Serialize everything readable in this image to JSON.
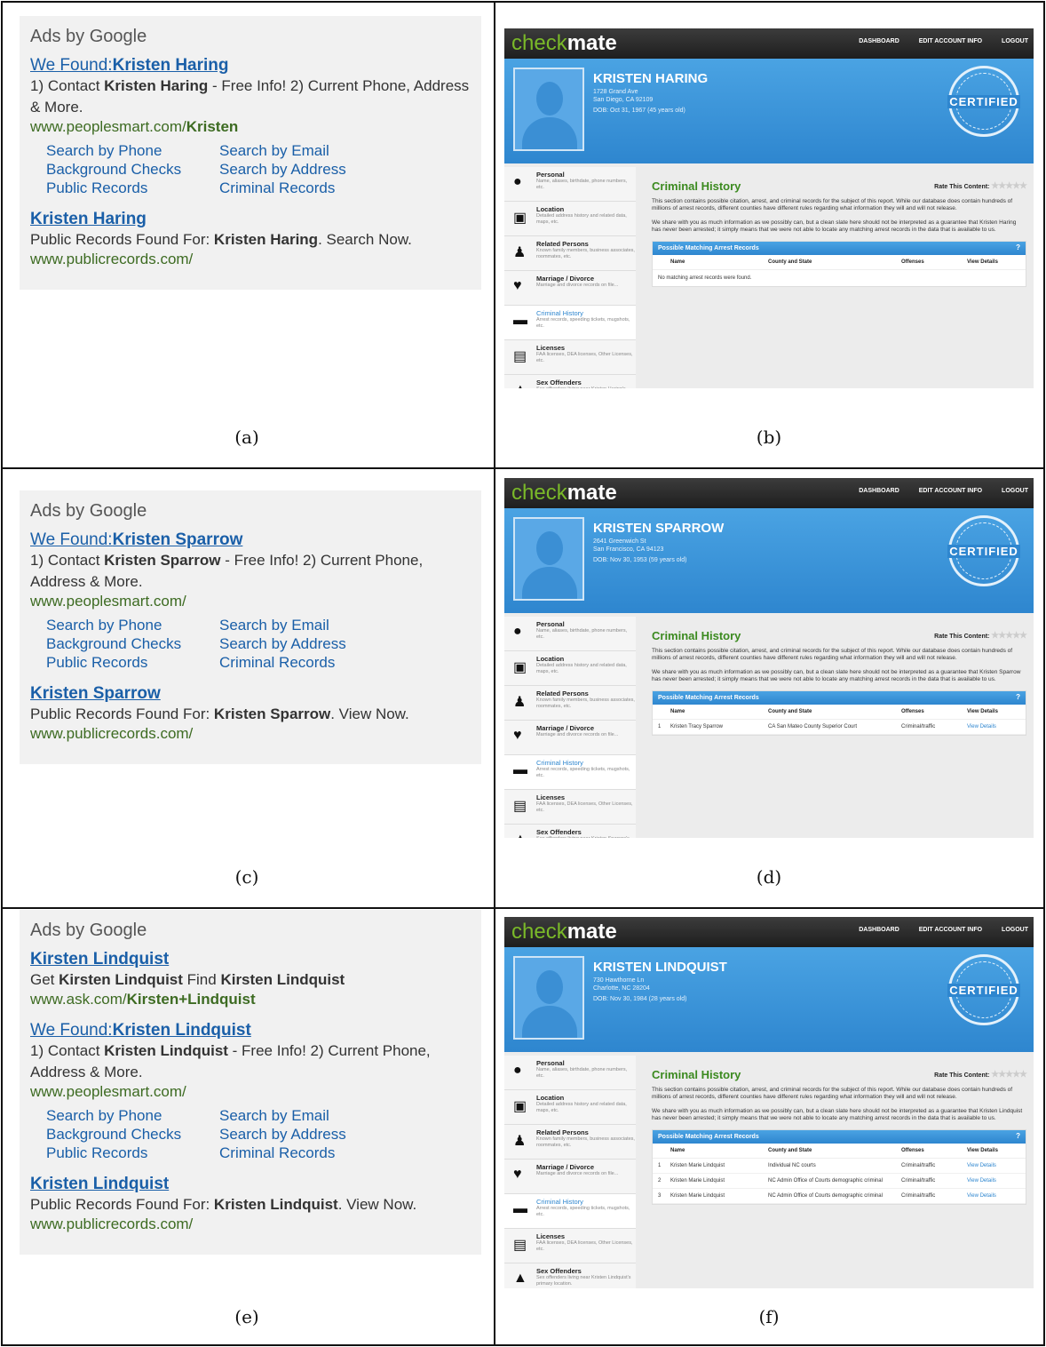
{
  "captions": [
    "(a)",
    "(b)",
    "(c)",
    "(d)",
    "(e)",
    "(f)"
  ],
  "ads": [
    {
      "header": "Ads by Google",
      "blocks": [
        {
          "title_prefix": "We Found:",
          "title_name": "Kristen Haring",
          "desc_a": "1) Contact ",
          "desc_name": "Kristen Haring",
          "desc_b": " - Free Info! 2) Current Phone, Address & More.",
          "url_prefix": "www.peoplesmart.com/",
          "url_bold": "Kristen",
          "links": [
            "Search by Phone",
            "Search by Email",
            "Background Checks",
            "Search by Address",
            "Public Records",
            "Criminal Records"
          ]
        },
        {
          "title_prefix": "",
          "title_name": "Kristen Haring",
          "desc_a": "Public Records Found For: ",
          "desc_name": "Kristen Haring",
          "desc_b": ". Search Now.",
          "url_prefix": "www.publicrecords.com/",
          "url_bold": ""
        }
      ]
    },
    {
      "header": "Ads by Google",
      "blocks": [
        {
          "title_prefix": "We Found:",
          "title_name": "Kristen Sparrow",
          "desc_a": "1) Contact ",
          "desc_name": "Kristen Sparrow",
          "desc_b": " - Free Info! 2) Current Phone, Address & More.",
          "url_prefix": "www.peoplesmart.com/",
          "url_bold": "",
          "links": [
            "Search by Phone",
            "Search by Email",
            "Background Checks",
            "Search by Address",
            "Public Records",
            "Criminal Records"
          ]
        },
        {
          "title_prefix": "",
          "title_name": "Kristen Sparrow",
          "desc_a": "Public Records Found For: ",
          "desc_name": "Kristen Sparrow",
          "desc_b": ". View Now.",
          "url_prefix": "www.publicrecords.com/",
          "url_bold": ""
        }
      ]
    },
    {
      "header": "Ads by Google",
      "blocks": [
        {
          "title_prefix": "",
          "title_name": "Kirsten Lindquist",
          "desc_a": "Get ",
          "desc_name": "Kirsten Lindquist",
          "desc_b": " Find ",
          "desc_name2": "Kirsten Lindquist",
          "url_prefix": "www.ask.com/",
          "url_bold": "Kirsten+Lindquist"
        },
        {
          "title_prefix": "We Found:",
          "title_name": "Kristen Lindquist",
          "desc_a": "1) Contact ",
          "desc_name": "Kristen Lindquist",
          "desc_b": " - Free Info! 2) Current Phone, Address & More.",
          "url_prefix": "www.peoplesmart.com/",
          "url_bold": "",
          "links": [
            "Search by Phone",
            "Search by Email",
            "Background Checks",
            "Search by Address",
            "Public Records",
            "Criminal Records"
          ]
        },
        {
          "title_prefix": "",
          "title_name": "Kristen Lindquist",
          "desc_a": "Public Records Found For: ",
          "desc_name": "Kristen Lindquist",
          "desc_b": ". View Now.",
          "url_prefix": "www.publicrecords.com/",
          "url_bold": ""
        }
      ]
    }
  ],
  "checkmate": {
    "logo_light": "check",
    "logo_bold": "mate",
    "nav": [
      "DASHBOARD",
      "EDIT ACCOUNT INFO",
      "LOGOUT"
    ],
    "seal": "CERTIFIED",
    "section_title": "Criminal History",
    "rate_label": "Rate This Content:",
    "p1": "This section contains possible citation, arrest, and criminal records for the subject of this report. While our database does contain hundreds of millions of arrest records, different counties have different rules regarding what information they will and will not release.",
    "table_title": "Possible Matching Arrest Records",
    "cols": [
      "Name",
      "County and State",
      "Offenses",
      "View Details"
    ],
    "no_records": "No matching arrest records were found.",
    "sidebar": [
      {
        "icon": "person-icon",
        "glyph": "●",
        "title": "Personal",
        "desc": "Name, aliases, birthdate, phone numbers, etc."
      },
      {
        "icon": "location-icon",
        "glyph": "▣",
        "title": "Location",
        "desc": "Detailed address history and related data, maps, etc."
      },
      {
        "icon": "related-persons-icon",
        "glyph": "♟",
        "title": "Related Persons",
        "desc": "Known family members, business associates, roommates, etc."
      },
      {
        "icon": "heart-icon",
        "glyph": "♥",
        "title": "Marriage / Divorce",
        "desc": "Marriage and divorce records on file..."
      },
      {
        "icon": "gun-icon",
        "glyph": "▬",
        "title": "Criminal History",
        "desc": "Arrest records, speeding tickets, mugshots, etc."
      },
      {
        "icon": "license-icon",
        "glyph": "▤",
        "title": "Licenses",
        "desc": "FAA licenses, DEA licenses, Other Licenses, etc."
      },
      {
        "icon": "warning-icon",
        "glyph": "▲",
        "title": "Sex Offenders",
        "desc_a": "Sex offenders living near ",
        "desc_b": "'s primary location."
      }
    ],
    "profiles": [
      {
        "name": "KRISTEN HARING",
        "addr1": "1728 Grand Ave",
        "addr2": "San Diego, CA 92109",
        "dob": "DOB:  Oct 31, 1967 (45 years old)",
        "first_last": "Kristen Haring",
        "p2": "We share with you as much information as we possibly can, but a clean slate here should not be interpreted as a guarantee that Kristen Haring has never been arrested; it simply means that we were not able to locate any matching arrest records in the data that is available to us.",
        "rows": []
      },
      {
        "name": "KRISTEN SPARROW",
        "addr1": "2641 Greenwich St",
        "addr2": "San Francisco, CA 94123",
        "dob": "DOB:  Nov 30, 1953 (59 years old)",
        "first_last": "Kristen Sparrow",
        "p2": "We share with you as much information as we possibly can, but a clean slate here should not be interpreted as a guarantee that Kristen Sparrow has never been arrested; it simply means that we were not able to locate any matching arrest records in the data that is available to us.",
        "rows": [
          [
            "1",
            "Kristen Tracy Sparrow",
            "CA San Mateo County Superior Court",
            "Criminal/traffic",
            "View Details"
          ]
        ]
      },
      {
        "name": "KRISTEN LINDQUIST",
        "addr1": "730 Hawthorne Ln",
        "addr2": "Charlotte, NC 28204",
        "dob": "DOB:  Nov 30, 1984 (28 years old)",
        "first_last": "Kristen Lindquist",
        "p2": "We share with you as much information as we possibly can, but a clean slate here should not be interpreted as a guarantee that Kristen Lindquist has never been arrested; it simply means that we were not able to locate any matching arrest records in the data that is available to us.",
        "rows": [
          [
            "1",
            "Kristen Marie Lindquist",
            "Individual NC courts",
            "Criminal/traffic",
            "View Details"
          ],
          [
            "2",
            "Kristen Marie Lindquist",
            "NC Admin Office of Courts demographic criminal",
            "Criminal/traffic",
            "View Details"
          ],
          [
            "3",
            "Kristen Marie Lindquist",
            "NC Admin Office of Courts demographic criminal",
            "Criminal/traffic",
            "View Details"
          ]
        ]
      }
    ]
  },
  "colors": {
    "link": "#1a5fa8",
    "url": "#3d6b22",
    "brand_green": "#7ab929",
    "brand_blue": "#2e86cf"
  }
}
